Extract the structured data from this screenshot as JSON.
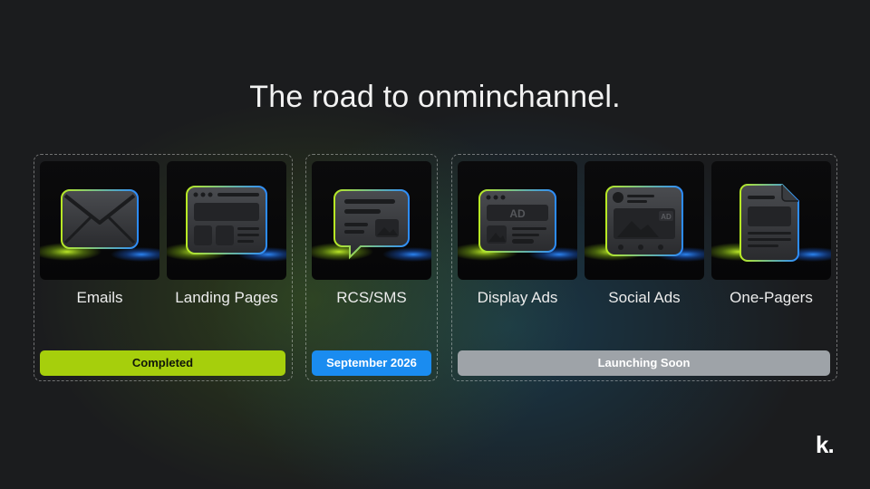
{
  "title": "The road to onminchannel.",
  "groups": [
    {
      "status": "Completed",
      "status_color": "#a6cf0c",
      "items": [
        {
          "label": "Emails",
          "icon": "envelope-icon"
        },
        {
          "label": "Landing Pages",
          "icon": "landing-page-icon"
        }
      ]
    },
    {
      "status": "September 2026",
      "status_color": "#1a8cf0",
      "items": [
        {
          "label": "RCS/SMS",
          "icon": "chat-bubble-icon",
          "icon_text": ""
        }
      ]
    },
    {
      "status": "Launching Soon",
      "status_color": "#9ea3a8",
      "items": [
        {
          "label": "Display Ads",
          "icon": "display-ad-icon",
          "icon_text": "AD"
        },
        {
          "label": "Social Ads",
          "icon": "social-ad-icon",
          "icon_text": "AD"
        },
        {
          "label": "One-Pagers",
          "icon": "document-icon"
        }
      ]
    }
  ],
  "colors": {
    "glow_green": "#b6e61e",
    "glow_blue": "#1f7cff"
  },
  "logo": "k."
}
